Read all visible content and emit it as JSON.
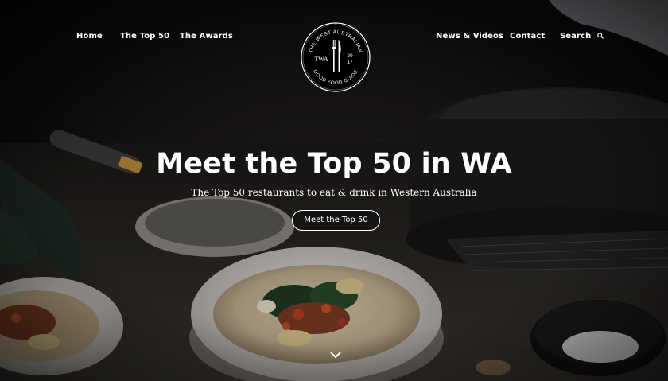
{
  "nav": {
    "left": [
      "Home",
      "The Top 50",
      "The Awards"
    ],
    "right": [
      "News & Videos",
      "Contact"
    ],
    "search_label": "Search"
  },
  "logo": {
    "text_top": "THE WEST AUSTRALIAN",
    "text_bottom": "GOOD FOOD GUIDE",
    "year_top": "20",
    "year_bottom": "17",
    "monogram": "TWA"
  },
  "hero": {
    "headline": "Meet the Top 50 in WA",
    "subheading": "The Top 50 restaurants to eat & drink in Western Australia",
    "cta_label": "Meet the Top 50"
  },
  "icons": {
    "search": "search-icon",
    "scroll": "chevron-down-icon",
    "logo_glyphs": "fork-knife-icon"
  }
}
